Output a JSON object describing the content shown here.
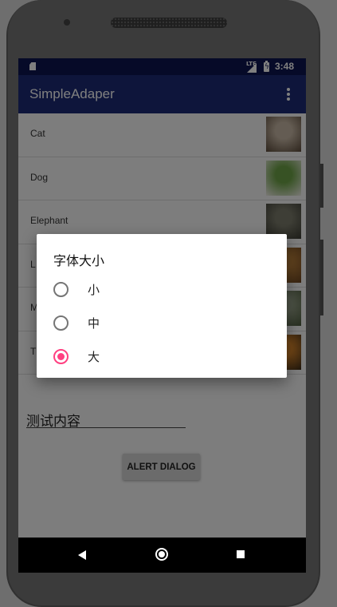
{
  "statusbar": {
    "network": "LTE",
    "time": "3:48"
  },
  "appbar": {
    "title": "SimpleAdaper"
  },
  "list": [
    {
      "label": "Cat",
      "thumb": "cat-image",
      "colors": [
        "#c9b9a6",
        "#5b4a3a"
      ]
    },
    {
      "label": "Dog",
      "thumb": "dog-image",
      "colors": [
        "#6fa548",
        "#f2efe9"
      ]
    },
    {
      "label": "Elephant",
      "thumb": "elephant-image",
      "colors": [
        "#7c7c6c",
        "#3c3c34"
      ]
    },
    {
      "label": "L",
      "thumb": "lion-image",
      "colors": [
        "#c0843c",
        "#6a4320"
      ]
    },
    {
      "label": "M",
      "thumb": "monkey-image",
      "colors": [
        "#9aa58c",
        "#4c5a3c"
      ]
    },
    {
      "label": "T",
      "thumb": "tiger-image",
      "colors": [
        "#e08a2c",
        "#3a2a18"
      ]
    }
  ],
  "content": {
    "text": "测试内容",
    "button_label": "ALERT DIALOG"
  },
  "dialog": {
    "title": "字体大小",
    "options": [
      {
        "label": "小",
        "checked": false
      },
      {
        "label": "中",
        "checked": false
      },
      {
        "label": "大",
        "checked": true
      }
    ]
  },
  "colors": {
    "primary_dark": "#0d1450",
    "primary": "#1d2a76",
    "accent": "#ff4081"
  }
}
